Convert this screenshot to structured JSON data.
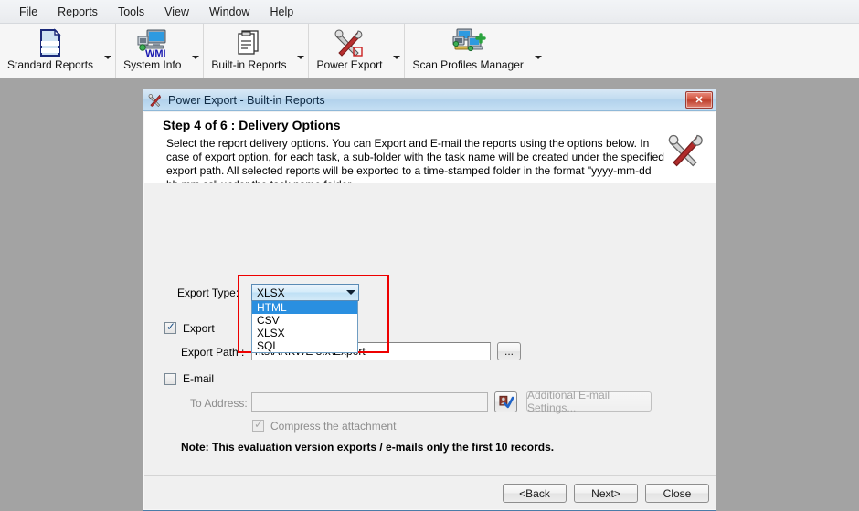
{
  "menubar": {
    "items": [
      {
        "label": "File"
      },
      {
        "label": "Reports"
      },
      {
        "label": "Tools"
      },
      {
        "label": "View"
      },
      {
        "label": "Window"
      },
      {
        "label": "Help"
      }
    ]
  },
  "toolbar": {
    "buttons": [
      {
        "label": "Standard Reports",
        "icon": "document-page-icon"
      },
      {
        "label": "System Info",
        "icon": "wmi-computer-icon"
      },
      {
        "label": "Built-in Reports",
        "icon": "clipboard-report-icon"
      },
      {
        "label": "Power Export",
        "icon": "wrench-screwdriver-icon"
      },
      {
        "label": "Scan Profiles Manager",
        "icon": "network-computers-icon"
      }
    ]
  },
  "dialog": {
    "title": "Power Export - Built-in Reports",
    "title_icon": "wrench-screwdriver-icon",
    "close_label": "✕",
    "step_label": "Step 4 of 6",
    "step_separator": ": Delivery Options",
    "step_title": "Step 4 of 6     : Delivery Options",
    "description": "  Select the report delivery options. You can Export and E-mail the reports using the options below. In case of export option, for each task, a sub-folder with the task name will be created under the specified export path. All selected reports will be exported to a time-stamped folder in the format \"yyyy-mm-dd hh.mm.ss\" under the task name folder.",
    "form": {
      "export_type_label": "Export Type:",
      "export_type_value": "XLSX",
      "export_type_options": [
        {
          "label": "HTML",
          "selected": true
        },
        {
          "label": "CSV",
          "selected": false
        },
        {
          "label": "XLSX",
          "selected": false
        },
        {
          "label": "SQL",
          "selected": false
        }
      ],
      "export_checkbox_label": "Export",
      "export_checkbox_checked": "✓",
      "export_path_label": "Export Path :",
      "export_path_value": "nts\\ARKWE 8.x\\Export",
      "browse_button_label": "...",
      "email_checkbox_label": "E-mail",
      "to_address_label": "To Address:",
      "to_address_value": "",
      "to_address_placeholder": "",
      "address_book_icon": "address-book-check-icon",
      "additional_settings_label": "Additional E-mail Settings...",
      "compress_label": "Compress the attachment",
      "compress_checked": "✓",
      "note": "Note: This evaluation version exports / e-mails only the first 10 records."
    },
    "footer": {
      "back_label": "<Back",
      "next_label": "Next>",
      "close_label": "Close"
    }
  },
  "colors": {
    "desktop_bg": "#a3a3a3",
    "dialog_border": "#4a7ca8",
    "highlight_red": "#ee0000",
    "dropdown_selection": "#2a8fe0",
    "accent_blue": "#2e88c7"
  }
}
